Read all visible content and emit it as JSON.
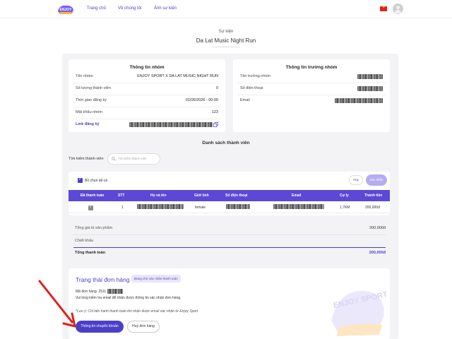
{
  "header": {
    "logo_text": "ENJOY",
    "nav": [
      "Trang chủ",
      "Về chúng tôi",
      "Ảnh sự kiện"
    ],
    "flag_color": "#da251d"
  },
  "page": {
    "section": "Sự kiện",
    "title": "Da Lat Music Night Run"
  },
  "group_info": {
    "title": "Thông tin nhóm",
    "rows": [
      {
        "label": "Tên nhóm",
        "value": "ENJOY SPORT X DA LAT MUSIC NIGHT RUN"
      },
      {
        "label": "Số lượng thành viên",
        "value": "0"
      },
      {
        "label": "Thời gian đăng ký",
        "value": "01/05/2026 - 00:00"
      },
      {
        "label": "Mật khẩu nhóm",
        "value": "123"
      }
    ],
    "link_label": "Link đăng ký"
  },
  "leader_info": {
    "title": "Thông tin trưởng nhóm",
    "rows": [
      {
        "label": "Tên trưởng nhóm"
      },
      {
        "label": "Số điện thoại"
      },
      {
        "label": "Email"
      }
    ]
  },
  "members": {
    "title": "Danh sách thành viên",
    "search_label": "Tìm kiếm thành viên",
    "search_placeholder": "Tìm kiếm thành viên",
    "deselect_all": "Bỏ chọn tất cả",
    "cancel": "Hủy",
    "confirm": "Xác nhận",
    "columns": [
      "Đã thanh toán",
      "STT",
      "Họ và tên",
      "Giới tính",
      "Số điện thoại",
      "Email",
      "Cự ly",
      "Thành tiền"
    ],
    "rows": [
      {
        "paid": true,
        "stt": "1",
        "gender": "female",
        "distance": "1,7KM",
        "amount": "200,000đ"
      }
    ]
  },
  "totals": {
    "product_label": "Tổng giá trị sản phẩm",
    "product_value": "200,000đ",
    "discount_label": "Chiết khấu",
    "total_label": "Tổng thanh toán",
    "total_value": "200,000đ"
  },
  "order_status": {
    "title": "Trạng thái đơn hàng",
    "badge": "Đang chờ xác nhận thanh toán",
    "order_code_label": "Mã đơn hàng: 2511",
    "check_email": "Vui lòng kiểm tra email để nhận được thông tin xác nhận đơn hàng.",
    "note": "*Lưu ý: Chỉ tiến hành thanh toán khi nhận được email xác nhận từ Enjoy Sport",
    "transfer_button": "Thông tin chuyển khoản",
    "cancel_button": "Huỷ đơn hàng",
    "watermark": "ENJOY SPORT"
  },
  "colors": {
    "accent": "#4b3fc7",
    "table_header": "#5b48d6",
    "arrow": "#e0201b"
  }
}
